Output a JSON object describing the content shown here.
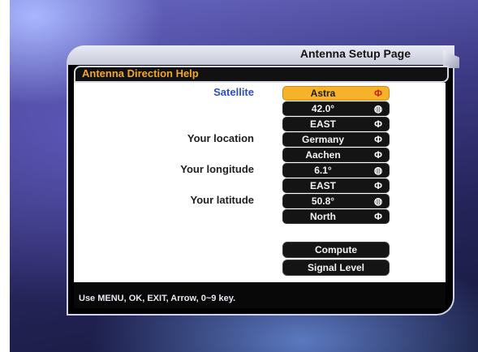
{
  "header": {
    "page_title": "Antenna Setup Page",
    "subtitle": "Antenna Direction Help"
  },
  "labels": {
    "satellite": "Satellite",
    "your_location": "Your location",
    "your_longitude": "Your longitude",
    "your_latitude": "Your latitude"
  },
  "fields": {
    "satellite_name": "Astra",
    "satellite_position": "42.0°",
    "satellite_direction": "EAST",
    "country": "Germany",
    "city": "Aachen",
    "longitude_value": "6.1°",
    "longitude_direction": "EAST",
    "latitude_value": "50.8°",
    "latitude_direction": "North"
  },
  "buttons": {
    "compute": "Compute",
    "signal_level": "Signal Level"
  },
  "footer": {
    "help_line_2": "Use MENU, OK, EXIT, Arrow, 0~9 key."
  },
  "colors": {
    "selected_field": "#f6b32a",
    "subtitle_text": "#f2a826",
    "accent_label": "#2e4fb8"
  },
  "icons": {
    "left_right_arrows": "left-right-arrow-icon",
    "digit_entry": "digit-entry-icon"
  }
}
